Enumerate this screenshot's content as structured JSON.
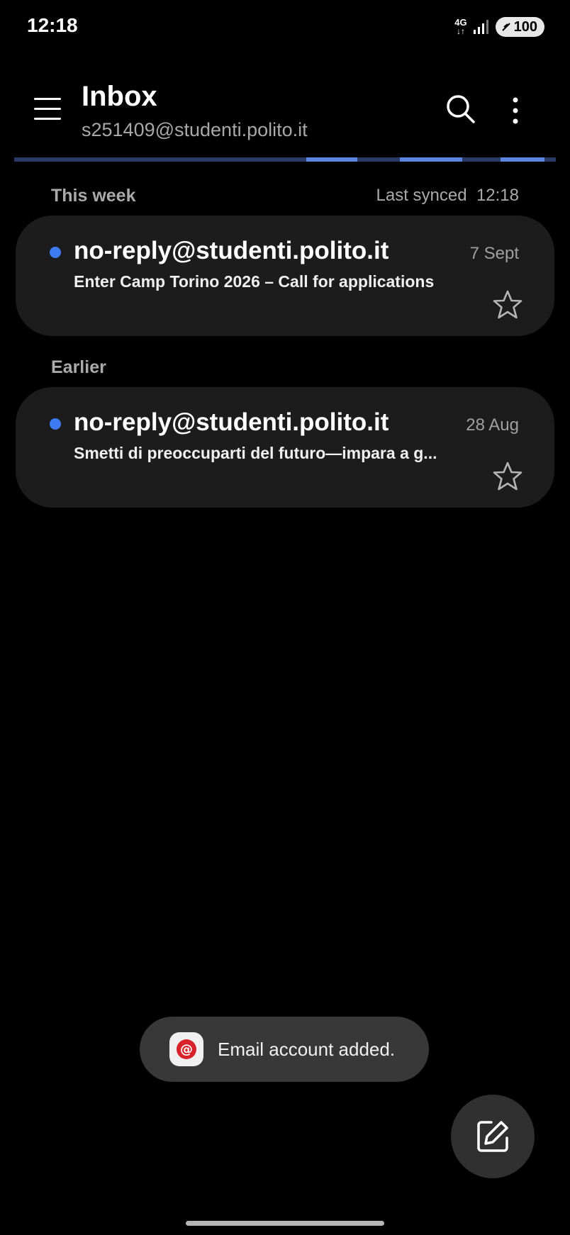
{
  "status_bar": {
    "time": "12:18",
    "network": "4G",
    "battery": "100",
    "icons": [
      "signal-icon",
      "battery-icon"
    ]
  },
  "header": {
    "title": "Inbox",
    "account": "s251409@studenti.polito.it",
    "icons": [
      "menu-icon",
      "search-icon",
      "more-options-icon"
    ]
  },
  "sections": [
    {
      "label": "This week",
      "synced_label": "Last synced",
      "synced_time": "12:18",
      "emails": [
        {
          "sender": "no-reply@studenti.polito.it",
          "subject": "Enter Camp Torino 2026 – Call for applications",
          "date": "7 Sept",
          "unread": true,
          "starred": false
        }
      ]
    },
    {
      "label": "Earlier",
      "emails": [
        {
          "sender": "no-reply@studenti.polito.it",
          "subject": "Smetti di preoccuparti del futuro—impara a g...",
          "date": "28 Aug",
          "unread": true,
          "starred": false
        }
      ]
    }
  ],
  "toast": {
    "text": "Email account added.",
    "icon": "email-app-icon"
  },
  "fab": {
    "icon": "compose-icon"
  },
  "colors": {
    "background": "#000000",
    "card": "#1c1c1c",
    "unread_dot": "#3d7bf4",
    "progress_track": "#2a3a66",
    "progress_fill": "#5b84e0"
  }
}
